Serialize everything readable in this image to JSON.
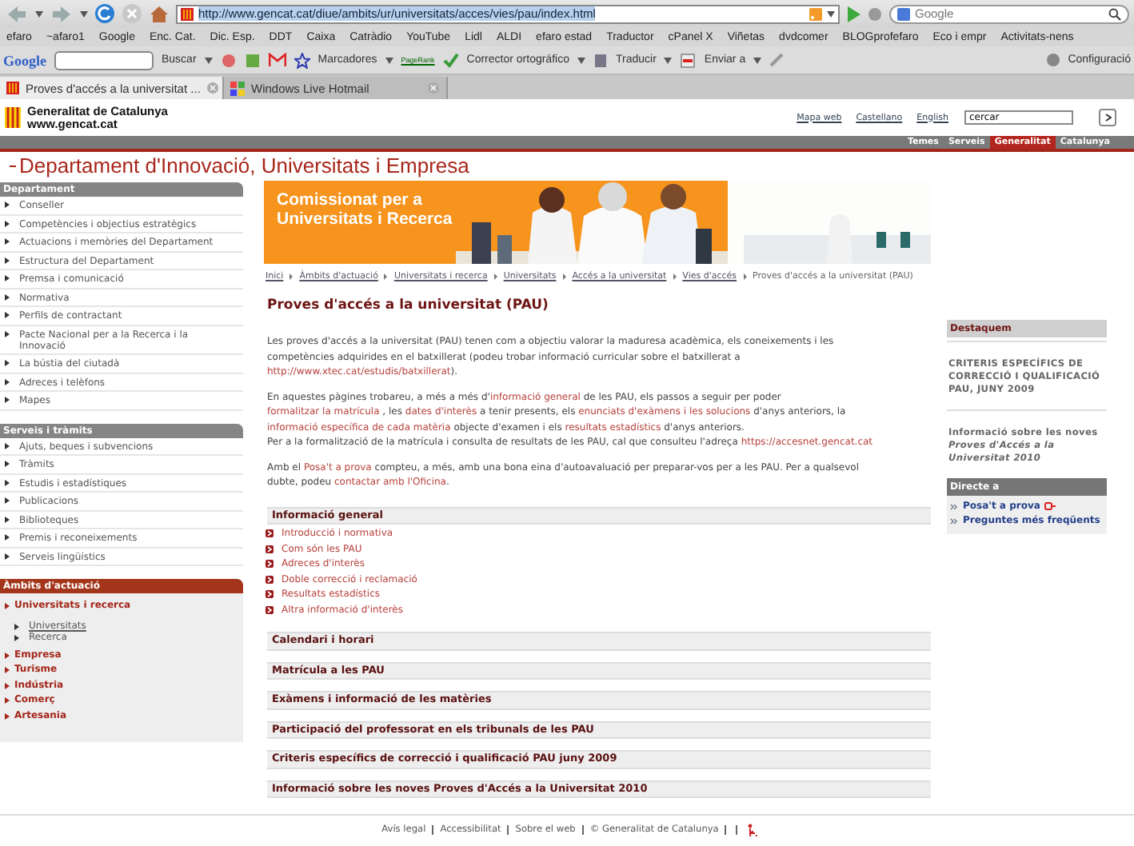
{
  "browser": {
    "url": "http://www.gencat.cat/diue/ambits/ur/universitats/acces/vies/pau/index.html",
    "search_placeholder": "Google",
    "bookmarks": [
      "efaro",
      "~afaro1",
      "Google",
      "Enc. Cat.",
      "Dic. Esp.",
      "DDT",
      "Caixa",
      "Catràdio",
      "YouTube",
      "Lidl",
      "ALDI",
      "efaro estad",
      "Traductor",
      "cPanel X",
      "Viñetas",
      "dvdcomer",
      "BLOGprofefaro",
      "Eco i empr",
      "Activitats-nens"
    ],
    "toolbar": {
      "logo": "Google",
      "search_button": "Buscar",
      "bookmarks_menu": "Marcadores",
      "pagerank": "PageRank",
      "spellcheck": "Corrector ortográfico",
      "translate": "Traducir",
      "send": "Enviar a",
      "settings": "Configuració"
    },
    "tabs": [
      {
        "title": "Proves d'accés a la universitat ...",
        "selected": true
      },
      {
        "title": "Windows Live Hotmail",
        "selected": false
      }
    ]
  },
  "header": {
    "site_name": "Generalitat de Catalunya",
    "site_url": "www.gencat.cat",
    "links": [
      "Mapa web",
      "Castellano",
      "English"
    ],
    "search_value": "cercar"
  },
  "top_nav": [
    {
      "label": "Temes",
      "selected": false
    },
    {
      "label": "Serveis",
      "selected": false
    },
    {
      "label": "Generalitat",
      "selected": true
    },
    {
      "label": "Catalunya",
      "selected": false
    }
  ],
  "department_title": "Departament d'Innovació, Universitats i Empresa",
  "sidebar": [
    {
      "title": "Departament",
      "kind": "plain",
      "items": [
        {
          "label": "Conseller"
        },
        {
          "label": "Competències i objectius estratègics"
        },
        {
          "label": "Actuacions i memòries del Departament"
        },
        {
          "label": "Estructura del Departament"
        },
        {
          "label": "Premsa i comunicació"
        },
        {
          "label": "Normativa"
        },
        {
          "label": "Perfils de contractant"
        },
        {
          "label": "Pacte Nacional per a la Recerca i la Innovació"
        },
        {
          "label": "La bústia del ciutadà"
        },
        {
          "label": "Adreces i telèfons"
        },
        {
          "label": "Mapes"
        }
      ]
    },
    {
      "title": "Serveis i tràmits",
      "kind": "plain",
      "items": [
        {
          "label": "Ajuts, beques i subvencions"
        },
        {
          "label": "Tràmits"
        },
        {
          "label": "Estudis i estadístiques"
        },
        {
          "label": "Publicacions"
        },
        {
          "label": "Biblioteques"
        },
        {
          "label": "Premis i reconeixements"
        },
        {
          "label": "Serveis lingüístics"
        }
      ]
    },
    {
      "title": "Àmbits d'actuació",
      "kind": "highlight",
      "items": [
        {
          "label": "Universitats i recerca",
          "children": [
            {
              "label": "Universitats",
              "selected": true
            },
            {
              "label": "Recerca",
              "selected": false
            }
          ]
        },
        {
          "label": "Empresa"
        },
        {
          "label": "Turisme"
        },
        {
          "label": "Indústria"
        },
        {
          "label": "Comerç"
        },
        {
          "label": "Artesania"
        }
      ]
    }
  ],
  "banner": {
    "title": "Comissionat per a Universitats i Recerca"
  },
  "breadcrumb": [
    "Inici",
    "Àmbits d'actuació",
    "Universitats i recerca",
    "Universitats",
    "Accés a la universitat",
    "Vies d'accés",
    "Proves d'accés a la universitat (PAU)"
  ],
  "page_title": "Proves d'accés a la universitat (PAU)",
  "paragraphs": [
    {
      "lines": [
        [
          {
            "text": "Les proves d'accés a la universitat (PAU) tenen com a objectiu valorar la maduresa acadèmica, els coneixements i les competències adquirides en el batxillerat (podeu trobar informació curricular sobre el batxillerat a "
          },
          {
            "text": "http://www.xtec.cat/estudis/batxillerat",
            "link": true
          },
          {
            "text": ")."
          }
        ]
      ]
    },
    {
      "lines": [
        [
          {
            "text": "En aquestes pàgines trobareu, a més a més d'"
          },
          {
            "text": "informació general",
            "link": true
          },
          {
            "text": " de les PAU, els passos a seguir per poder "
          },
          {
            "text": "formalitzar la matrícula",
            "link": true
          },
          {
            "text": " , les "
          },
          {
            "text": "dates d'interès",
            "link": true
          },
          {
            "text": " a tenir presents, els "
          },
          {
            "text": "enunciats d'exàmens i les solucions",
            "link": true
          },
          {
            "text": " d'anys anteriors, la "
          },
          {
            "text": "informació específica de cada matèria",
            "link": true
          },
          {
            "text": " objecte d'examen i els "
          },
          {
            "text": "resultats estadístics",
            "link": true
          },
          {
            "text": " d'anys anteriors."
          }
        ],
        [
          {
            "text": "Per a la formalització de la matrícula i consulta de resultats de les PAU, cal que consulteu l'adreça "
          },
          {
            "text": "https://accesnet.gencat.cat",
            "link": true
          }
        ]
      ]
    },
    {
      "lines": [
        [
          {
            "text": "Amb el "
          },
          {
            "text": "Posa't a prova",
            "link": true
          },
          {
            "text": " compteu, a més, amb una bona eina d'autoavaluació per preparar-vos per a les PAU. Per a qualsevol dubte, podeu "
          },
          {
            "text": "contactar amb l'Oficina",
            "link": true
          },
          {
            "text": "."
          }
        ]
      ]
    }
  ],
  "sections": [
    {
      "title": "Informació general",
      "links": [
        "Introducció i normativa",
        "Com són les PAU",
        "Adreces d'interès",
        "Doble correcció i reclamació",
        "Resultats estadístics",
        "Altra informació d'interès"
      ]
    },
    {
      "title": "Calendari i horari"
    },
    {
      "title": "Matrícula a les PAU"
    },
    {
      "title": "Exàmens i informació de les matèries"
    },
    {
      "title": "Participació del professorat en els tribunals de les PAU"
    },
    {
      "title": "Criteris específics de correcció i qualificació PAU juny 2009"
    },
    {
      "title": "Informació sobre les noves Proves d'Accés a la Universitat 2010"
    }
  ],
  "highlights": {
    "title": "Destaquem",
    "items": [
      "CRITERIS ESPECÍFICS DE CORRECCIÓ I QUALIFICACIÓ PAU, JUNY 2009",
      "Informació sobre les noves *Proves d'Accés a la Universitat 2010*"
    ]
  },
  "direct": {
    "title": "Directe a",
    "links": [
      {
        "label": "Posa't a prova",
        "external": true
      },
      {
        "label": "Preguntes més freqüents",
        "external": false
      }
    ]
  },
  "footer": [
    "Avís legal",
    "Accessibilitat",
    "Sobre el web",
    "© Generalitat de Catalunya"
  ]
}
